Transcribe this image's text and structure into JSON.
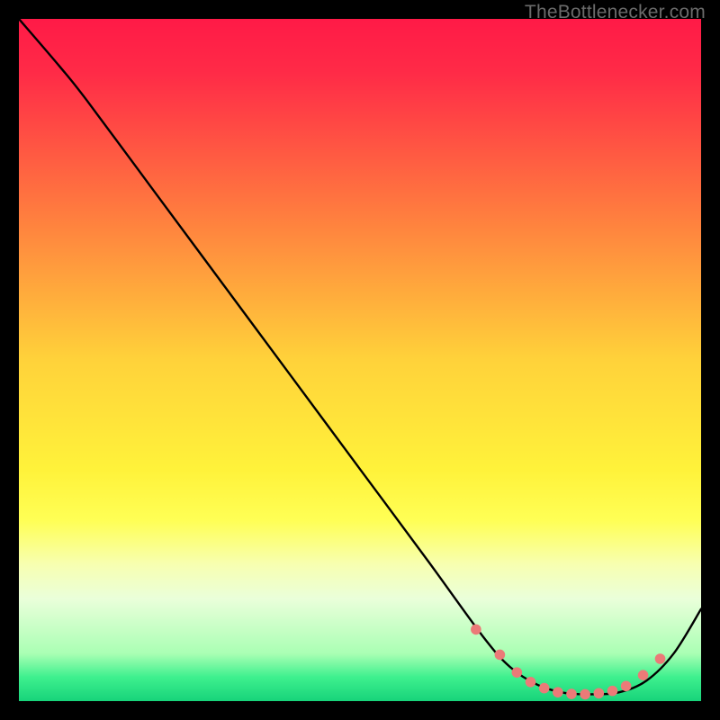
{
  "attribution": "TheBottlenecker.com",
  "chart_data": {
    "type": "line",
    "title": "",
    "xlabel": "",
    "ylabel": "",
    "xlim": [
      0,
      100
    ],
    "ylim": [
      0,
      100
    ],
    "gradient_stops": [
      {
        "offset": 0.0,
        "color": "#ff1a47"
      },
      {
        "offset": 0.08,
        "color": "#ff2b47"
      },
      {
        "offset": 0.28,
        "color": "#ff7a3f"
      },
      {
        "offset": 0.5,
        "color": "#ffd23a"
      },
      {
        "offset": 0.66,
        "color": "#fff23a"
      },
      {
        "offset": 0.735,
        "color": "#ffff55"
      },
      {
        "offset": 0.8,
        "color": "#f7ffb1"
      },
      {
        "offset": 0.85,
        "color": "#eaffda"
      },
      {
        "offset": 0.93,
        "color": "#aaffb4"
      },
      {
        "offset": 0.965,
        "color": "#3ef08e"
      },
      {
        "offset": 1.0,
        "color": "#17d37a"
      }
    ],
    "series": [
      {
        "name": "curve",
        "x": [
          0,
          6,
          10,
          20,
          30,
          40,
          50,
          60,
          68,
          72,
          76,
          80,
          84,
          88,
          92,
          96,
          100
        ],
        "y": [
          100,
          93,
          88,
          74.5,
          61,
          47.5,
          34,
          20.5,
          9.5,
          5,
          2.4,
          1.2,
          1.0,
          1.3,
          3,
          7,
          13.5
        ]
      }
    ],
    "markers": {
      "name": "bottleneck-band",
      "x": [
        67,
        70.5,
        73,
        75,
        77,
        79,
        81,
        83,
        85,
        87,
        89,
        91.5,
        94
      ],
      "y": [
        10.5,
        6.8,
        4.2,
        2.8,
        1.9,
        1.3,
        1.05,
        1.0,
        1.15,
        1.5,
        2.2,
        3.8,
        6.2
      ],
      "color": "#eb7a78",
      "r": 5.8
    }
  }
}
